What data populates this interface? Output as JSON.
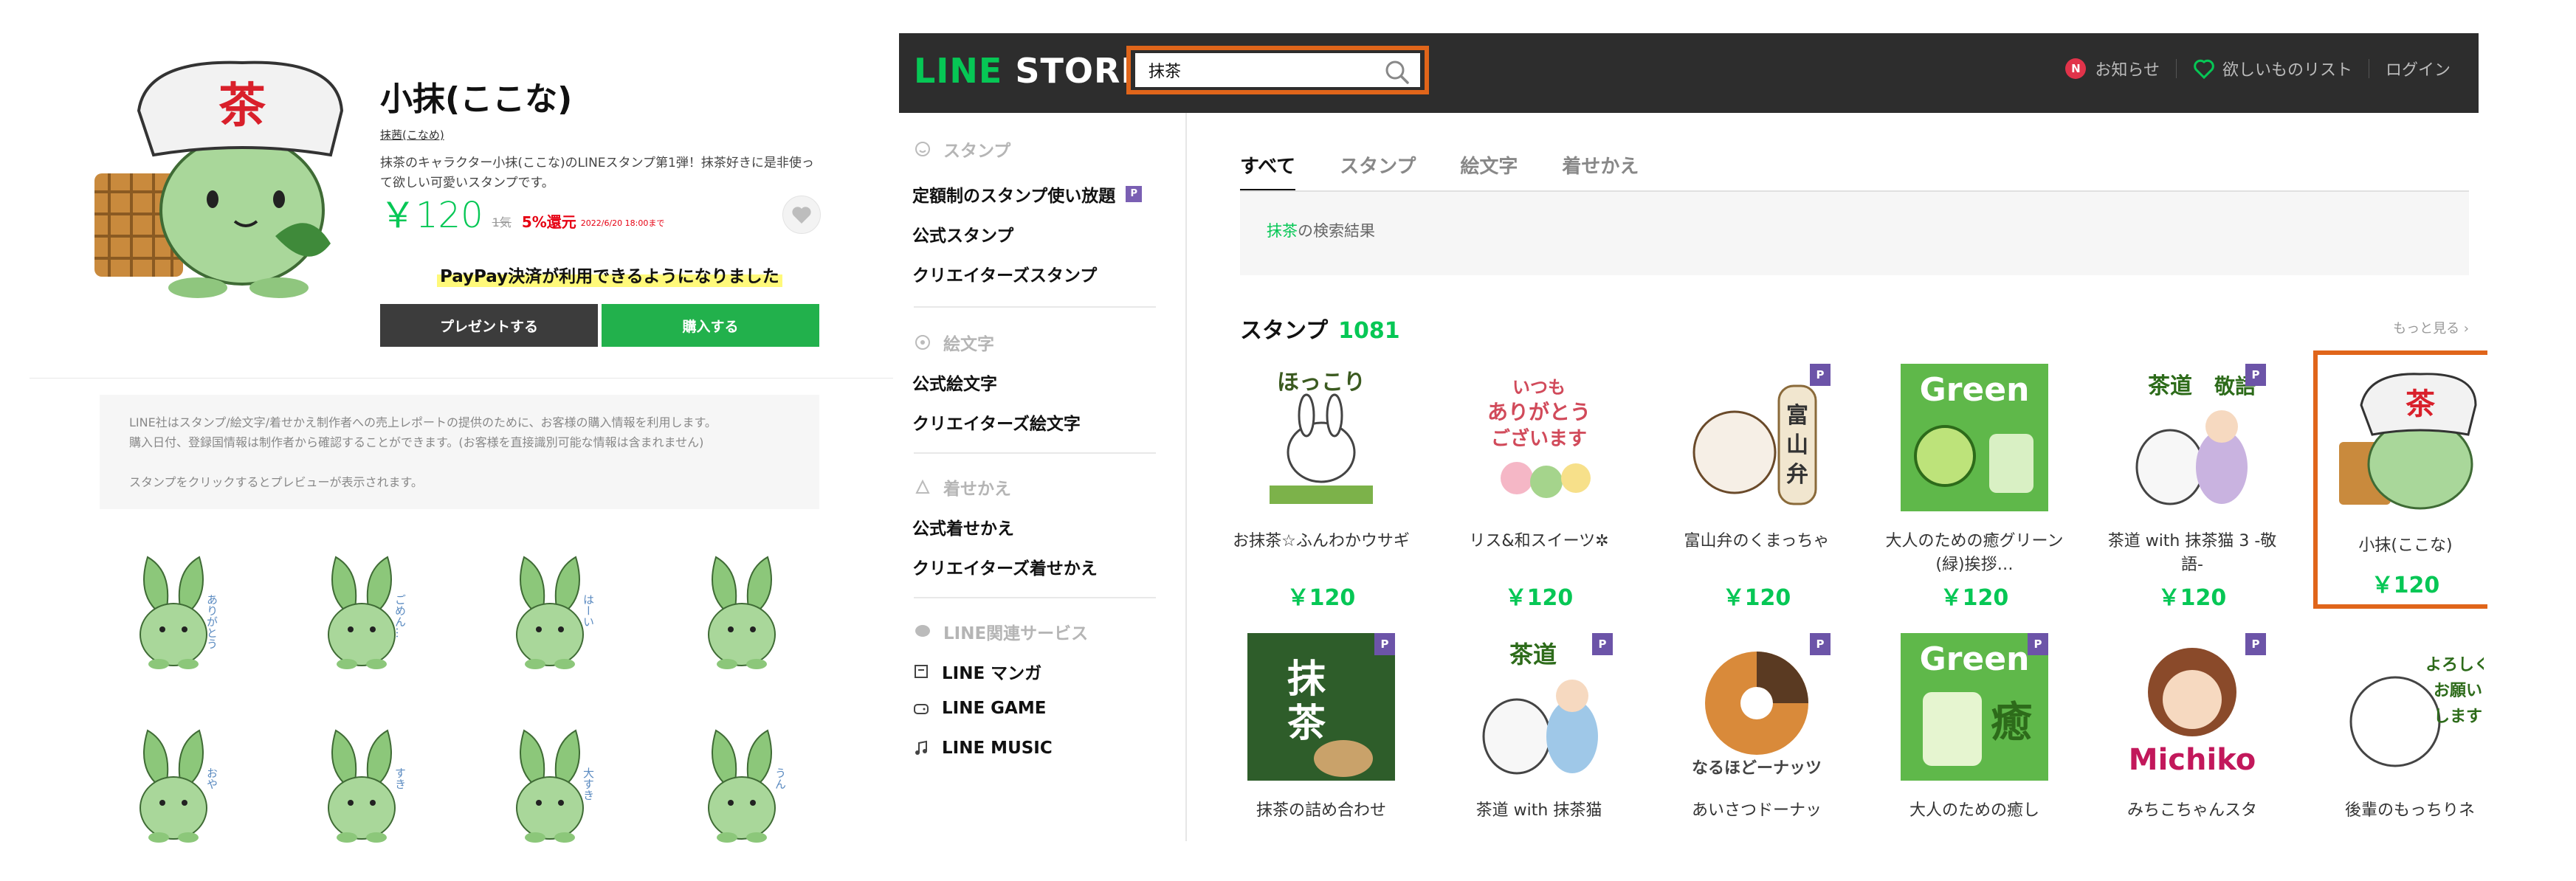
{
  "product": {
    "title": "小抹(ここな)",
    "author": "抹茜(こなめ)",
    "description": "抹茶のキャラクター小抹(ここな)のLINEスタンプ第1弾！抹茶好きに是非使って欲しい可愛いスタンプです。",
    "price": "￥120",
    "coin": "1気",
    "cashback": "5%還元",
    "cashback_date": "2022/6/20 18:00まで",
    "paypay": "PayPay決済が利用できるようになりました",
    "gift_label": "プレゼントする",
    "buy_label": "購入する",
    "hat_char": "茶",
    "notice_line1": "LINE社はスタンプ/絵文字/着せかえ制作者への売上レポートの提供のために、お客様の購入情報を利用します。",
    "notice_line2": "購入日付、登録国情報は制作者から確認することができます。(お客様を直接識別可能な情報は含まれません)",
    "notice_line3": "スタンプをクリックするとプレビューが表示されます。",
    "stickers": [
      {
        "text": "ありがとう"
      },
      {
        "text": "ごめん…"
      },
      {
        "text": "はーい"
      },
      {
        "text": ""
      },
      {
        "text": "おや"
      },
      {
        "text": "すき"
      },
      {
        "text": "大すき"
      },
      {
        "text": "うん"
      }
    ]
  },
  "store": {
    "logo_green": "LINE",
    "logo_white": " STORE",
    "search_value": "抹茶",
    "nav": {
      "news_badge": "N",
      "news": "お知らせ",
      "wishlist": "欲しいものリスト",
      "login": "ログイン"
    },
    "sidebar": {
      "sec_stamp": "スタンプ",
      "item_subscription": "定額制のスタンプ使い放題",
      "subscription_badge": "P",
      "item_official_stamp": "公式スタンプ",
      "item_creators_stamp": "クリエイターズスタンプ",
      "sec_emoji": "絵文字",
      "item_official_emoji": "公式絵文字",
      "item_creators_emoji": "クリエイターズ絵文字",
      "sec_theme": "着せかえ",
      "item_official_theme": "公式着せかえ",
      "item_creators_theme": "クリエイターズ着せかえ",
      "sec_services": "LINE関連サービス",
      "item_manga": "LINE マンガ",
      "item_game": "LINE GAME",
      "item_music": "LINE MUSIC"
    },
    "tabs": [
      "すべて",
      "スタンプ",
      "絵文字",
      "着せかえ"
    ],
    "result_keyword": "抹茶",
    "result_suffix": "の検索結果",
    "section_title": "スタンプ",
    "section_count": "1081",
    "more": "もっと見る ›",
    "cards_row1": [
      {
        "name": "お抹茶☆ふんわかウサギ",
        "price": "￥120",
        "premium": false
      },
      {
        "name": "リス&和スイーツ✲",
        "price": "￥120",
        "premium": false
      },
      {
        "name": "富山弁のくまっちゃ",
        "price": "￥120",
        "premium": true
      },
      {
        "name": "大人のための癒グリーン(緑)挨拶…",
        "price": "￥120",
        "premium": false
      },
      {
        "name": "茶道 with 抹茶猫 3 -敬語-",
        "price": "￥120",
        "premium": true
      },
      {
        "name": "小抹(ここな)",
        "price": "￥120",
        "premium": false
      }
    ],
    "cards_row2": [
      {
        "name": "抹茶の詰め合わせ",
        "premium": true
      },
      {
        "name": "茶道 with 抹茶猫",
        "premium": true
      },
      {
        "name": "あいさつドーナッ",
        "premium": true
      },
      {
        "name": "大人のための癒し",
        "premium": true
      },
      {
        "name": "みちこちゃんスタ",
        "premium": true
      },
      {
        "name": "後輩のもっちりネ",
        "premium": false
      }
    ],
    "thumb_text": {
      "hokkori": "ほっこり",
      "itsumo": "いつも ありがとう ございます",
      "toyama": "富山弁",
      "green": "Green",
      "sado": "茶道",
      "keigo": "敬語",
      "matcha": "抹茶",
      "iyashi": "癒",
      "michiko": "Michiko",
      "naruhodo": "なるほどーナッツ",
      "yoroshiku": "よろしくお願いします"
    }
  }
}
